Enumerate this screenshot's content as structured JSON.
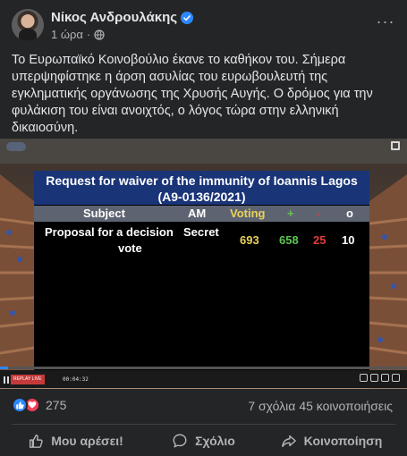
{
  "post": {
    "author": "Νίκος Ανδρουλάκης",
    "time": "1 ώρα",
    "separator": "·",
    "more": "···",
    "text": "Το Ευρωπαϊκό Κοινοβούλιο έκανε το καθήκον του. Σήμερα υπερψηφίστηκε η άρση ασυλίας του ευρωβουλευτή της εγκληματικής οργάνωσης της Χρυσής Αυγής. Ο δρόμος για την φυλάκιση του είναι ανοιχτός, ο λόγος τώρα στην ελληνική δικαιοσύνη."
  },
  "vote": {
    "title_line1": "Request for waiver of the immunity of Ioannis Lagos",
    "title_line2": "(A9-0136/2021)",
    "headers": {
      "subject": "Subject",
      "am": "AM",
      "voting": "Voting",
      "for": "+",
      "against": "-",
      "abstain": "o"
    },
    "row": {
      "subject_line1": "Proposal for a decision",
      "subject_line2": "vote",
      "voting": "Secret",
      "total": "693",
      "for": "658",
      "against": "25",
      "abstain": "10"
    },
    "colors": {
      "title_bg": "#1a3478",
      "header_bg": "#5e6371",
      "voting": "#e8d25a",
      "for": "#5fc452",
      "against": "#e23b3b"
    }
  },
  "player": {
    "live_badge": "REPLAY LIVE",
    "time": "00:04:32",
    "progress": 0.02
  },
  "engagement": {
    "reaction_count": "275",
    "comments": "7 σχόλια",
    "shares": "45 κοινοποιήσεις"
  },
  "actions": {
    "like": "Μου αρέσει!",
    "comment": "Σχόλιο",
    "share": "Κοινοποίηση"
  },
  "icons": [
    "verified-icon",
    "globe-icon",
    "like-icon",
    "love-icon",
    "comment-icon",
    "share-icon",
    "pause-icon",
    "expand-icon"
  ]
}
